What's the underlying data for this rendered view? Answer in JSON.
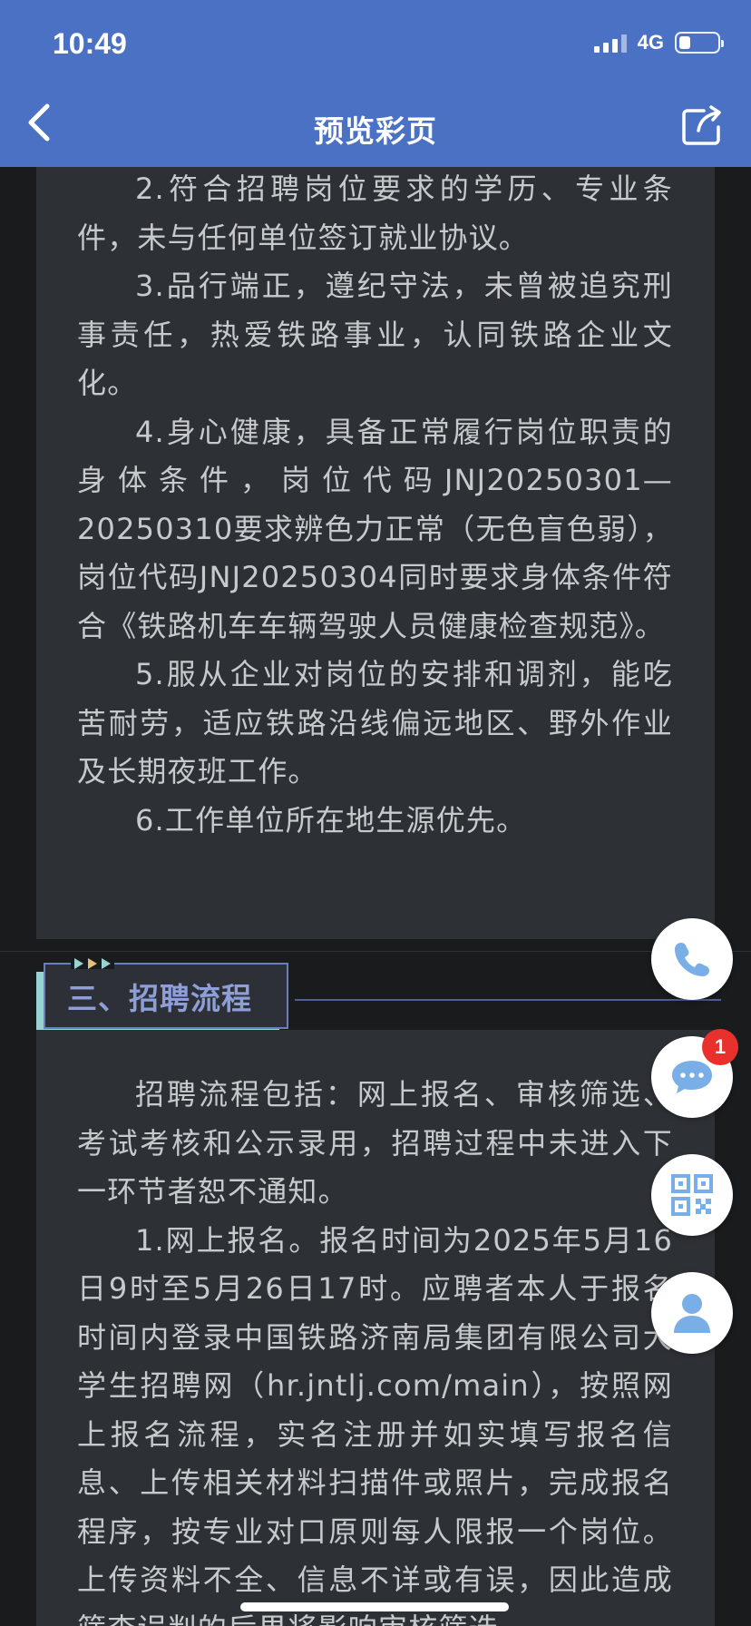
{
  "status_bar": {
    "time": "10:49",
    "network": "4G",
    "battery_level": 0.3
  },
  "nav": {
    "title": "预览彩页",
    "back_icon": "chevron-left-icon",
    "share_icon": "share-icon"
  },
  "content": {
    "section1_paragraphs": [
      "2.符合招聘岗位要求的学历、专业条件，未与任何单位签订就业协议。",
      "3.品行端正，遵纪守法，未曾被追究刑事责任，热爱铁路事业，认同铁路企业文化。",
      "4.身心健康，具备正常履行岗位职责的身体条件，岗位代码JNJ20250301—20250310要求辨色力正常（无色盲色弱），岗位代码JNJ20250304同时要求身体条件符合《铁路机车车辆驾驶人员健康检查规范》。",
      "5.服从企业对岗位的安排和调剂，能吃苦耐劳，适应铁路沿线偏远地区、野外作业及长期夜班工作。",
      "6.工作单位所在地生源优先。"
    ],
    "section2_heading": "三、招聘流程",
    "section2_paragraphs": [
      "招聘流程包括：网上报名、审核筛选、考试考核和公示录用，招聘过程中未进入下一环节者恕不通知。",
      "1.网上报名。报名时间为2025年5月16日9时至5月26日17时。应聘者本人于报名时间内登录中国铁路济南局集团有限公司大学生招聘网（hr.jntlj.com/main），按照网上报名流程，实名注册并如实填写报名信息、上传相关材料扫描件或照片，完成报名程序，按专业对口原则每人限报一个岗位。上传资料不全、信息不详或有误，因此造成筛查误判的后果将影响审核筛选。"
    ]
  },
  "floating_buttons": {
    "chat_badge": "1",
    "icons": [
      "phone-icon",
      "chat-icon",
      "qr-code-icon",
      "user-icon"
    ]
  },
  "colors": {
    "header_bg": "#4a71c4",
    "panel_bg": "#2d3136",
    "text": "#c7cacd",
    "heading_text": "#8d9ed8",
    "accent_teal": "#97d3d1",
    "badge": "#e8312d",
    "icon_blue": "#7aaee6"
  }
}
